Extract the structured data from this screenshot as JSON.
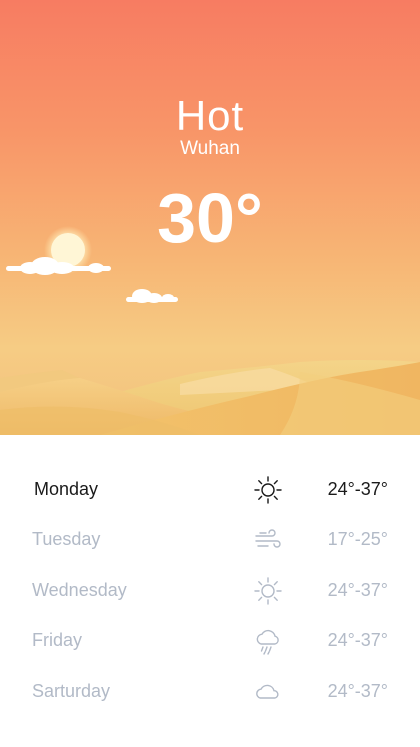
{
  "weather": {
    "condition": "Hot",
    "city": "Wuhan",
    "temperature": "30°"
  },
  "colors": {
    "sky_top": "#f77c62",
    "sky_bottom": "#f6cc84",
    "dune": "#f0c36a",
    "inactive_text": "#b2bac7",
    "active_text": "#1a1a1a"
  },
  "forecast": [
    {
      "day": "Monday",
      "range": "24°-37°",
      "icon": "sun-icon"
    },
    {
      "day": "Tuesday",
      "range": "17°-25°",
      "icon": "wind-icon"
    },
    {
      "day": "Wednesday",
      "range": "24°-37°",
      "icon": "sun-icon"
    },
    {
      "day": "Friday",
      "range": "24°-37°",
      "icon": "rain-cloud-icon"
    },
    {
      "day": "Sarturday",
      "range": "24°-37°",
      "icon": "cloud-icon"
    }
  ]
}
